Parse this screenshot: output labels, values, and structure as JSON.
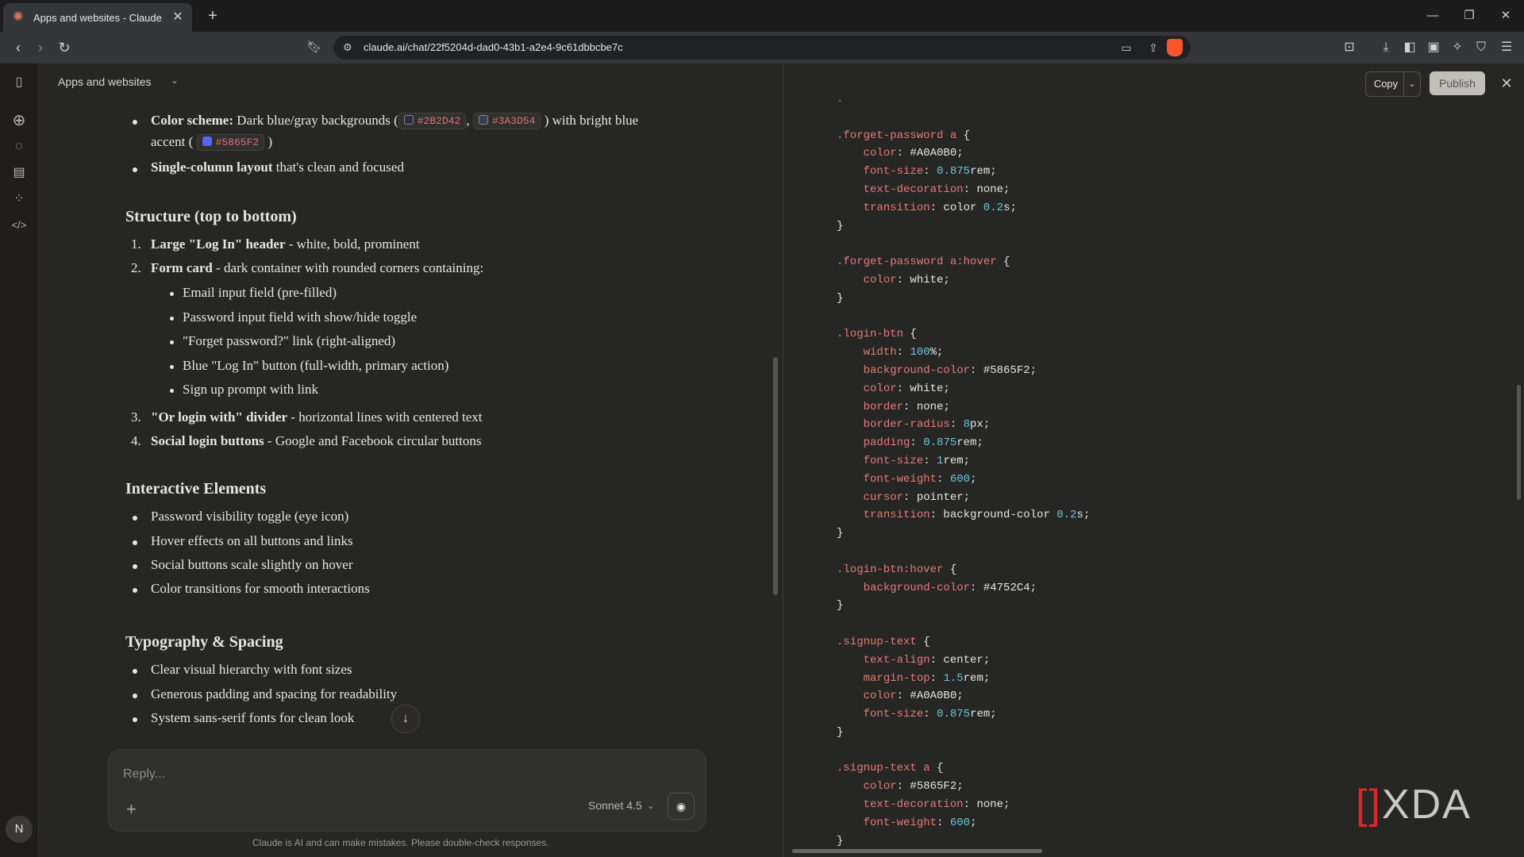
{
  "browser": {
    "tab_title": "Apps and websites - Claude",
    "url": "claude.ai/chat/22f5204d-dad0-43b1-a2e4-9c61dbbcbe7c"
  },
  "chat": {
    "title": "Apps and websites",
    "color_scheme_label": "Color scheme:",
    "color_scheme_text_1": "Dark blue/gray backgrounds (",
    "color_1": "#2B2D42",
    "color_2": "#3A3D54",
    "color_scheme_text_2": ") with bright blue",
    "color_scheme_text_3": "accent (",
    "color_3": "#5865F2",
    "color_scheme_text_4": ")",
    "single_col_bold": "Single-column layout",
    "single_col_rest": " that's clean and focused",
    "structure_heading": "Structure (top to bottom)",
    "s1_num": "1.",
    "s1_bold": "Large \"Log In\" header",
    "s1_rest": " - white, bold, prominent",
    "s2_num": "2.",
    "s2_bold": "Form card",
    "s2_rest": " - dark container with rounded corners containing:",
    "s2_sub": [
      "Email input field (pre-filled)",
      "Password input field with show/hide toggle",
      "\"Forget password?\" link (right-aligned)",
      "Blue \"Log In\" button (full-width, primary action)",
      "Sign up prompt with link"
    ],
    "s3_num": "3.",
    "s3_bold": "\"Or login with\" divider",
    "s3_rest": " - horizontal lines with centered text",
    "s4_num": "4.",
    "s4_bold": "Social login buttons",
    "s4_rest": " - Google and Facebook circular buttons",
    "interactive_heading": "Interactive Elements",
    "interactive_items": [
      "Password visibility toggle (eye icon)",
      "Hover effects on all buttons and links",
      "Social buttons scale slightly on hover",
      "Color transitions for smooth interactions"
    ],
    "typo_heading": "Typography & Spacing",
    "typo_items": [
      "Clear visual hierarchy with font sizes",
      "Generous padding and spacing for readability",
      "System sans-serif fonts for clean look"
    ]
  },
  "reply": {
    "placeholder": "Reply...",
    "model": "Sonnet 4.5",
    "disclaimer": "Claude is AI and can make mistakes. Please double-check responses."
  },
  "artifact": {
    "copy_label": "Copy",
    "publish_label": "Publish"
  },
  "watermark": {
    "text": "XDA"
  }
}
